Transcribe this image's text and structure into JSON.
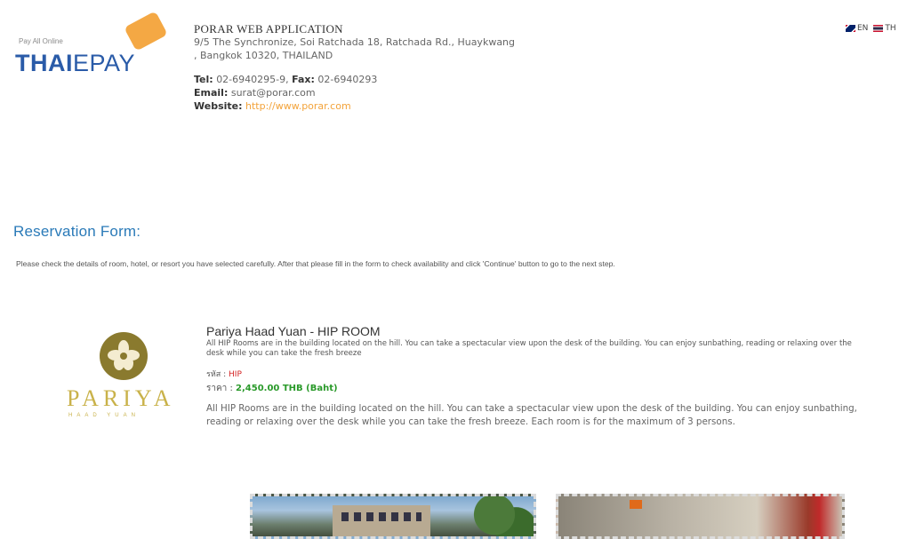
{
  "header": {
    "logo": {
      "tagline": "Pay All Online",
      "brand_part1": "THAI",
      "brand_part2": "EPAY"
    },
    "company_name": "PORAR WEB APPLICATION",
    "address_line1": "9/5 The Synchronize, Soi Ratchada 18, Ratchada Rd., Huaykwang",
    "address_line2": ", Bangkok 10320, THAILAND",
    "tel_label": "Tel:",
    "tel_value": "02-6940295-9,",
    "fax_label": "Fax:",
    "fax_value": "02-6940293",
    "email_label": "Email:",
    "email_value": "surat@porar.com",
    "website_label": "Website:",
    "website_value": "http://www.porar.com"
  },
  "language": {
    "en_label": "EN",
    "th_label": "TH"
  },
  "reservation": {
    "title": "Reservation Form:",
    "description": "Please check the details of room, hotel, or resort you have selected carefully. After that please fill in the form to check availability and click 'Continue' button to go to the next step."
  },
  "hotel": {
    "logo_name": "PARIYA",
    "logo_sub": "HAAD YUAN"
  },
  "room": {
    "title": "Pariya Haad Yuan - HIP ROOM",
    "short_desc": "All HIP Rooms are in the building located on the hill. You can take a spectacular view upon the desk of the building. You can enjoy sunbathing, reading or relaxing over the desk while you can take the fresh breeze",
    "code_label": "รหัส :",
    "code_value": "HIP",
    "price_label": "ราคา :",
    "price_value": "2,450.00 THB (Baht)",
    "long_desc": "All HIP Rooms are in the building located on the hill. You can take a spectacular view upon the desk of the building. You can enjoy sunbathing, reading or relaxing over the desk while you can take the fresh breeze. Each room is for the maximum of 3 persons."
  },
  "colors": {
    "title_blue": "#2a7ab8",
    "brand_blue": "#2a5ba8",
    "accent_orange": "#f3a33a",
    "code_red": "#d32222",
    "price_green": "#2a9a2a",
    "hotel_gold": "#c9b24a"
  }
}
